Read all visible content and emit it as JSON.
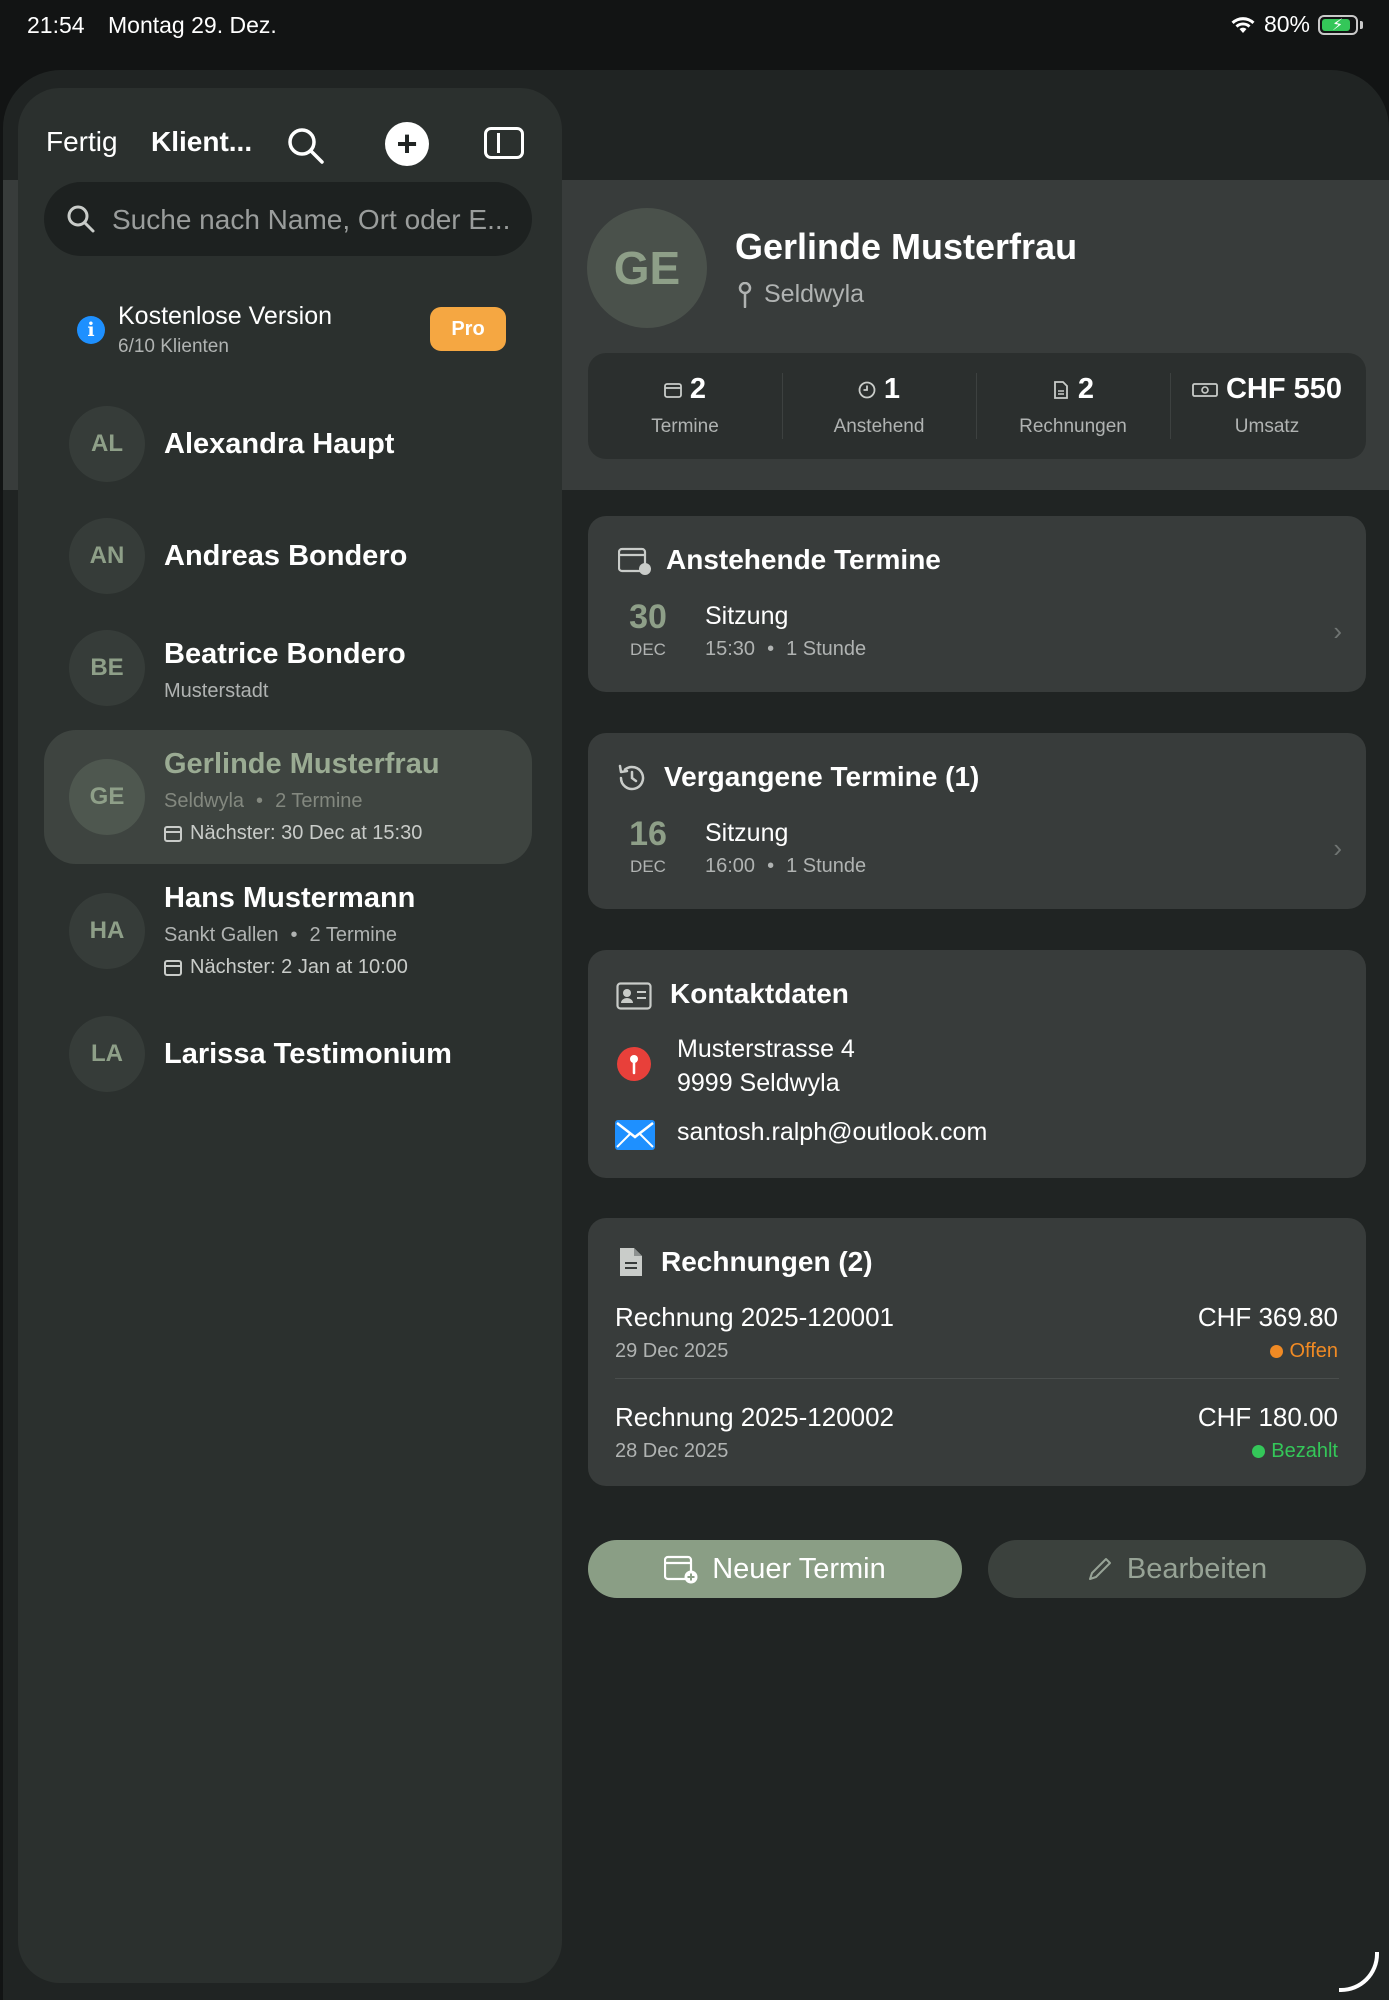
{
  "status_bar": {
    "time": "21:54",
    "date": "Montag 29. Dez.",
    "battery_percent": "80%"
  },
  "toolbar": {
    "done_label": "Fertig",
    "title": "Klient..."
  },
  "search": {
    "placeholder": "Suche nach Name, Ort oder E..."
  },
  "plan": {
    "title": "Kostenlose Version",
    "usage": "6/10 Klienten",
    "badge": "Pro"
  },
  "clients": [
    {
      "initials": "AL",
      "name": "Alexandra Haupt"
    },
    {
      "initials": "AN",
      "name": "Andreas Bondero"
    },
    {
      "initials": "BE",
      "name": "Beatrice Bondero",
      "location": "Musterstadt"
    },
    {
      "initials": "GE",
      "name": "Gerlinde Musterfrau",
      "location": "Seldwyla",
      "appointments": "2 Termine",
      "next": "Nächster: 30 Dec at 15:30",
      "selected": true
    },
    {
      "initials": "HA",
      "name": "Hans Mustermann",
      "location": "Sankt Gallen",
      "appointments": "2 Termine",
      "next": "Nächster: 2 Jan at 10:00"
    },
    {
      "initials": "LA",
      "name": "Larissa Testimonium"
    }
  ],
  "detail": {
    "initials": "GE",
    "name": "Gerlinde Musterfrau",
    "location": "Seldwyla",
    "stats": [
      {
        "value": "2",
        "label": "Termine",
        "icon": "calendar-icon"
      },
      {
        "value": "1",
        "label": "Anstehend",
        "icon": "clock-icon"
      },
      {
        "value": "2",
        "label": "Rechnungen",
        "icon": "document-icon"
      },
      {
        "value": "CHF 550",
        "label": "Umsatz",
        "icon": "banknote-icon"
      }
    ],
    "upcoming": {
      "title": "Anstehende Termine",
      "day": "30",
      "month": "DEC",
      "appt_title": "Sitzung",
      "time": "15:30",
      "duration": "1 Stunde"
    },
    "past": {
      "title": "Vergangene Termine (1)",
      "day": "16",
      "month": "DEC",
      "appt_title": "Sitzung",
      "time": "16:00",
      "duration": "1 Stunde"
    },
    "contact": {
      "title": "Kontaktdaten",
      "street": "Musterstrasse 4",
      "city": "9999 Seldwyla",
      "email": "santosh.ralph@outlook.com"
    },
    "invoices": {
      "title": "Rechnungen (2)",
      "items": [
        {
          "number": "Rechnung 2025-120001",
          "date": "29 Dec 2025",
          "amount": "CHF 369.80",
          "status": "Offen",
          "status_color": "#f08a24"
        },
        {
          "number": "Rechnung 2025-120002",
          "date": "28 Dec 2025",
          "amount": "CHF 180.00",
          "status": "Bezahlt",
          "status_color": "#34c759"
        }
      ]
    },
    "actions": {
      "new_appointment": "Neuer Termin",
      "edit": "Bearbeiten"
    }
  },
  "colors": {
    "accent": "#8a9e85",
    "pro": "#f5a742",
    "info": "#1e90ff",
    "open": "#f08a24",
    "paid": "#34c759"
  }
}
